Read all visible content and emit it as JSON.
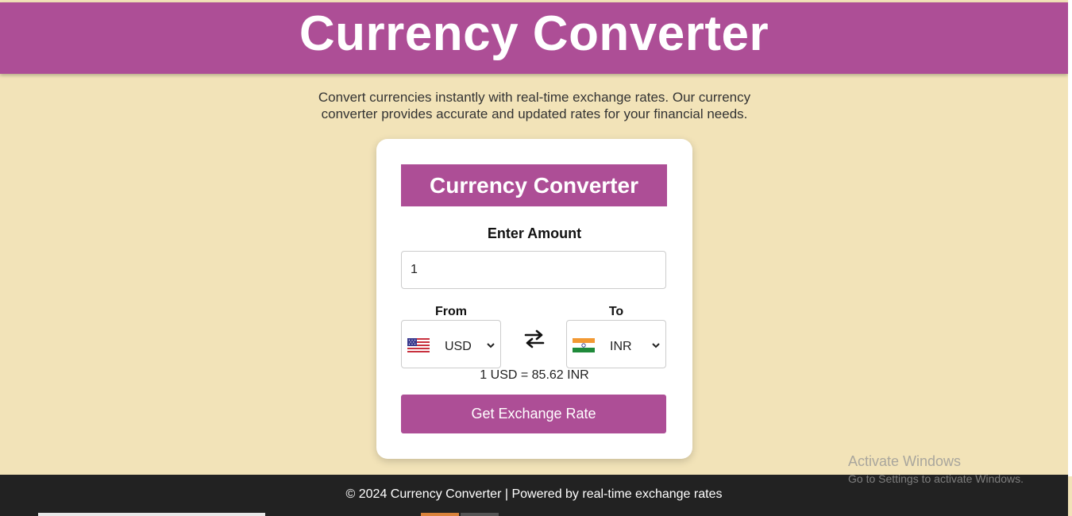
{
  "header": {
    "title": "Currency Converter"
  },
  "intro": {
    "text": "Convert currencies instantly with real-time exchange rates. Our currency converter provides accurate and updated rates for your financial needs."
  },
  "card": {
    "title": "Currency Converter",
    "amount_label": "Enter Amount",
    "amount_value": "1",
    "from_label": "From",
    "to_label": "To",
    "from_currency": {
      "code": "USD",
      "flag": "us-flag-icon"
    },
    "to_currency": {
      "code": "INR",
      "flag": "india-flag-icon"
    },
    "swap_icon": "swap-arrows-icon",
    "rate_text": "1 USD = 85.62 INR",
    "button_label": "Get Exchange Rate"
  },
  "footer": {
    "text": "© 2024 Currency Converter | Powered by real-time exchange rates"
  },
  "watermark": {
    "title": "Activate Windows",
    "subtitle": "Go to Settings to activate Windows."
  },
  "colors": {
    "accent": "#ad4e96",
    "background": "#f2e3b8",
    "footer": "#222222"
  }
}
